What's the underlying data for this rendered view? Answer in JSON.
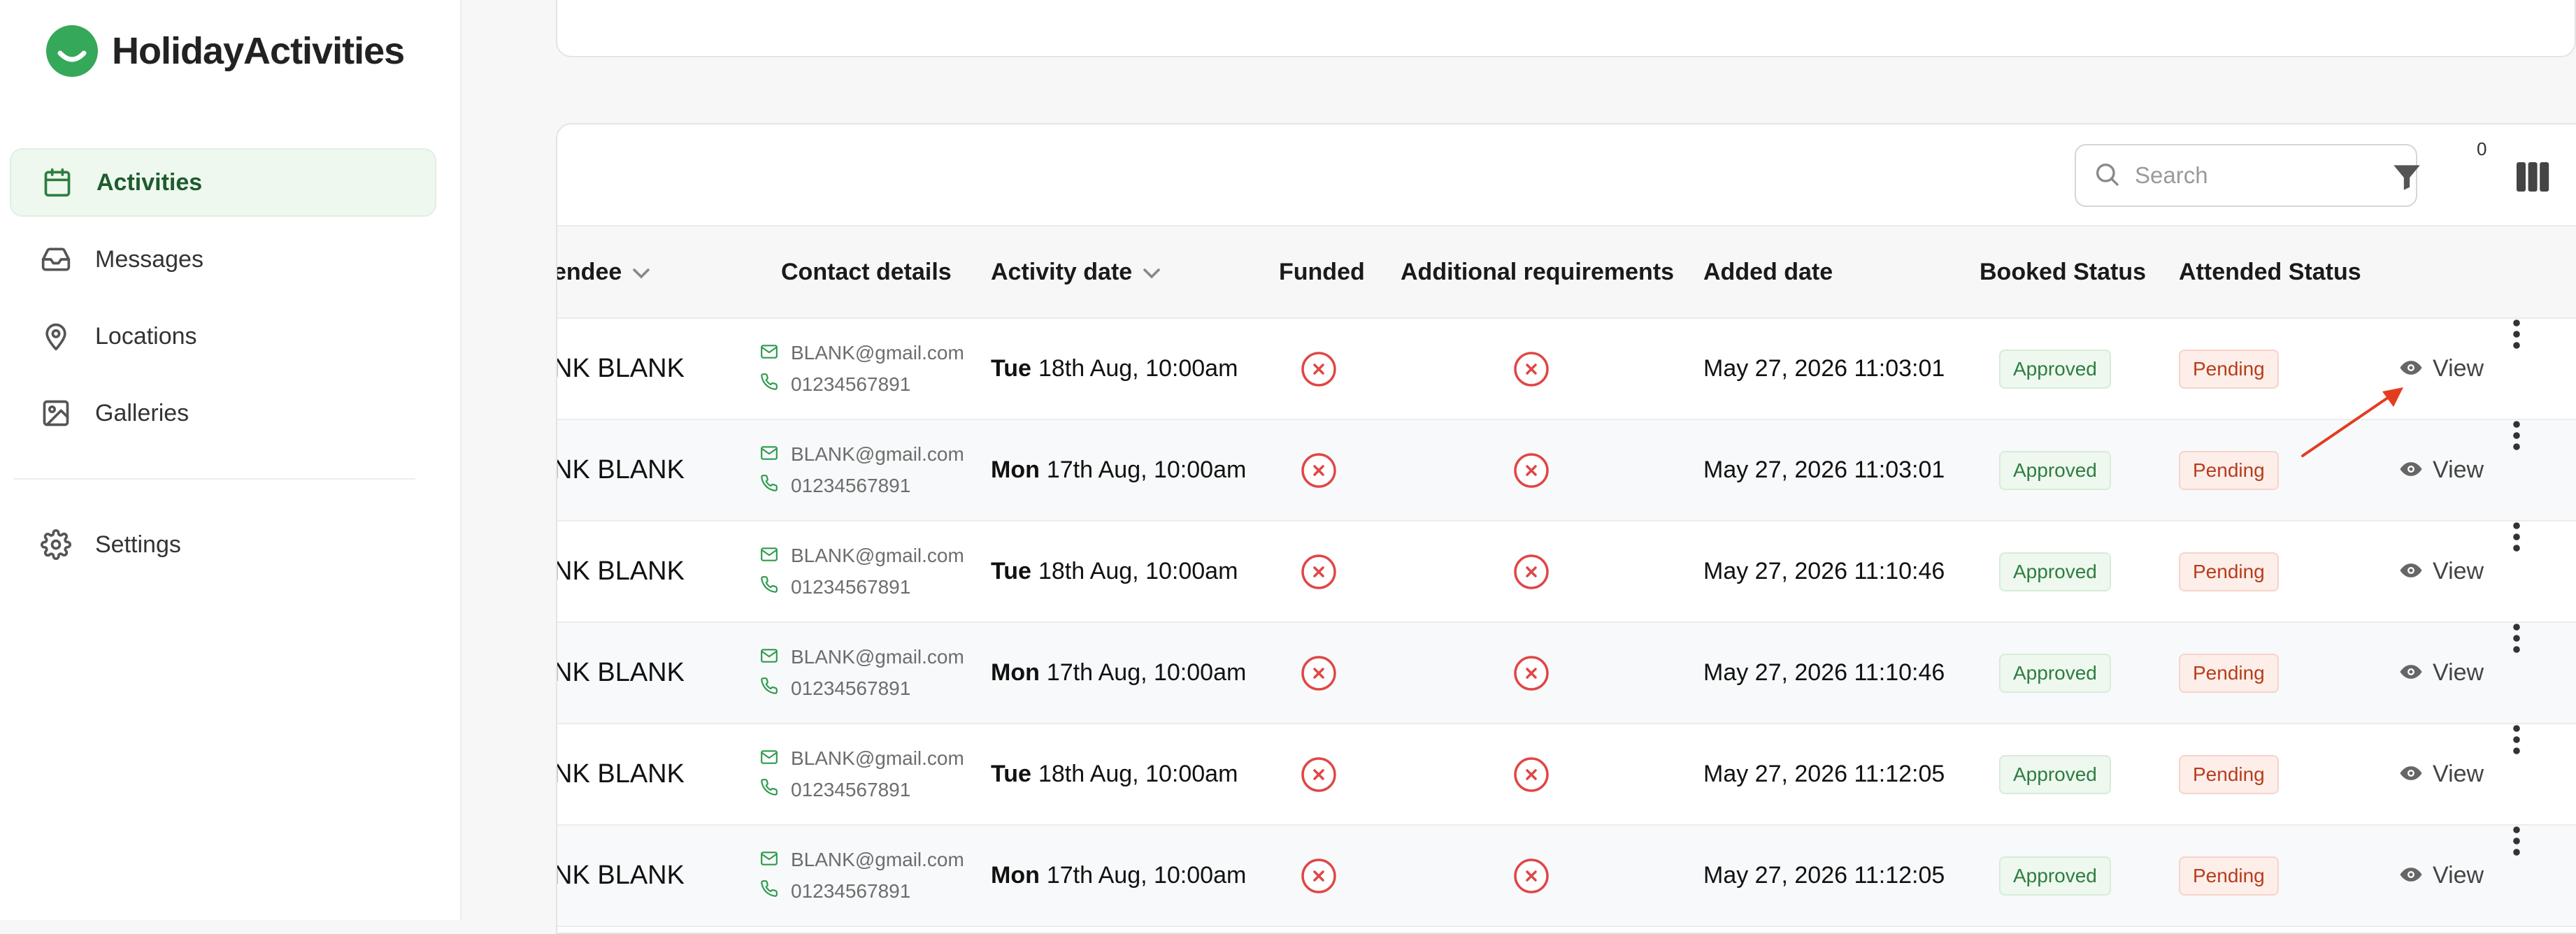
{
  "app": {
    "name": "HolidayActivities"
  },
  "colors": {
    "brand": "#35a85a",
    "active_bg": "#eef8ef",
    "error": "#e04646",
    "pending_text": "#b63d1c",
    "approved_text": "#2e7d3f",
    "arrow": "#e23d1f"
  },
  "sidebar": {
    "items": [
      {
        "label": "Activities",
        "icon": "calendar-icon",
        "active": true
      },
      {
        "label": "Messages",
        "icon": "inbox-icon",
        "active": false
      },
      {
        "label": "Locations",
        "icon": "location-pin-icon",
        "active": false
      },
      {
        "label": "Galleries",
        "icon": "image-icon",
        "active": false
      }
    ],
    "settings": {
      "label": "Settings",
      "icon": "gear-icon"
    }
  },
  "toolbar": {
    "search_placeholder": "Search",
    "filter_count": "0"
  },
  "table": {
    "columns": {
      "attendee": "endee",
      "contact": "Contact details",
      "activity_date": "Activity date",
      "funded": "Funded",
      "additional": "Additional requirements",
      "added": "Added date",
      "booked": "Booked Status",
      "attended": "Attended Status"
    },
    "view_label": "View",
    "rows": [
      {
        "attendee": "NK BLANK",
        "email": "BLANK@gmail.com",
        "phone": "01234567891",
        "day": "Tue",
        "date": "18th Aug, 10:00am",
        "added": "May 27, 2026 11:03:01",
        "booked": "Approved",
        "attended": "Pending"
      },
      {
        "attendee": "NK BLANK",
        "email": "BLANK@gmail.com",
        "phone": "01234567891",
        "day": "Mon",
        "date": "17th Aug, 10:00am",
        "added": "May 27, 2026 11:03:01",
        "booked": "Approved",
        "attended": "Pending"
      },
      {
        "attendee": "NK BLANK",
        "email": "BLANK@gmail.com",
        "phone": "01234567891",
        "day": "Tue",
        "date": "18th Aug, 10:00am",
        "added": "May 27, 2026 11:10:46",
        "booked": "Approved",
        "attended": "Pending"
      },
      {
        "attendee": "NK BLANK",
        "email": "BLANK@gmail.com",
        "phone": "01234567891",
        "day": "Mon",
        "date": "17th Aug, 10:00am",
        "added": "May 27, 2026 11:10:46",
        "booked": "Approved",
        "attended": "Pending"
      },
      {
        "attendee": "NK BLANK",
        "email": "BLANK@gmail.com",
        "phone": "01234567891",
        "day": "Tue",
        "date": "18th Aug, 10:00am",
        "added": "May 27, 2026 11:12:05",
        "booked": "Approved",
        "attended": "Pending"
      },
      {
        "attendee": "NK BLANK",
        "email": "BLANK@gmail.com",
        "phone": "01234567891",
        "day": "Mon",
        "date": "17th Aug, 10:00am",
        "added": "May 27, 2026 11:12:05",
        "booked": "Approved",
        "attended": "Pending"
      }
    ]
  }
}
